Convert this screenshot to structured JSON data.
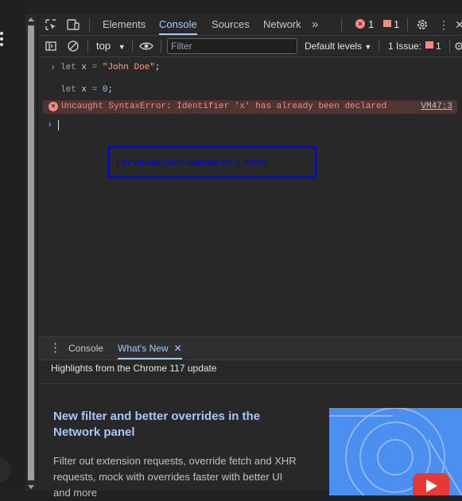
{
  "tabbar": {
    "tabs": [
      "Elements",
      "Console",
      "Sources",
      "Network"
    ],
    "active_tab": "Console",
    "more_tabs_glyph": "»",
    "error_count": "1",
    "issue_count": "1"
  },
  "toolbar": {
    "context": "top",
    "filter_placeholder": "Filter",
    "levels": "Default levels",
    "issues_label": "1 Issue:",
    "issues_count": "1"
  },
  "console": {
    "line1": {
      "kw": "let",
      "ident": "x",
      "op": "=",
      "str": "\"John Doe\"",
      "end": ";"
    },
    "line2": {
      "kw": "let",
      "ident": "x",
      "op": "=",
      "num": "0",
      "end": ";"
    },
    "error_text": "Uncaught SyntaxError: Identifier 'x' has already been declared",
    "error_source": "VM47:3"
  },
  "annotation": {
    "text": "Let Values Can't declare for 2 times"
  },
  "drawer": {
    "tabs": [
      "Console",
      "What's New"
    ],
    "active_tab": "What's New",
    "headline": "Highlights from the Chrome 117 update",
    "feature_title": "New filter and better overrides in the Network panel",
    "feature_desc": "Filter out extension requests, override fetch and XHR requests, mock with overrides faster with better UI and more"
  },
  "colors": {
    "accent": "#a8c7fa",
    "error": "#f28b82",
    "annotation": "#0000ee"
  }
}
